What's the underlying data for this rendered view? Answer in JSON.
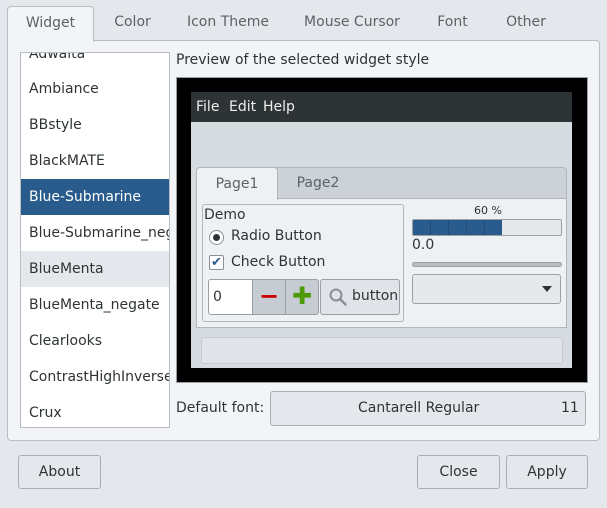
{
  "tabs": [
    "Widget",
    "Color",
    "Icon Theme",
    "Mouse Cursor",
    "Font",
    "Other"
  ],
  "active_tab": "Widget",
  "theme_list": {
    "items": [
      "Adwaita",
      "Ambiance",
      "BBstyle",
      "BlackMATE",
      "Blue-Submarine",
      "Blue-Submarine_negate",
      "BlueMenta",
      "BlueMenta_negate",
      "Clearlooks",
      "ContrastHighInverse",
      "Crux"
    ],
    "selected": "Blue-Submarine",
    "hovered": "BlueMenta"
  },
  "preview": {
    "label": "Preview of the selected widget style",
    "menu": [
      "File",
      "Edit",
      "Help"
    ],
    "inner_tabs": [
      "Page1",
      "Page2"
    ],
    "demo_label": "Demo",
    "radio_label": "Radio Button",
    "check_label": "Check Button",
    "check_mark": "✔",
    "spin_value": "0",
    "spin_minus": "−",
    "spin_plus": "✚",
    "button_label": "button",
    "progress_text": "60 %",
    "progress_fraction": 0.6,
    "scale_value": "0.0"
  },
  "default_font": {
    "label": "Default font:",
    "name": "Cantarell Regular",
    "size": "11"
  },
  "buttons": {
    "about": "About",
    "close": "Close",
    "apply": "Apply"
  },
  "colors": {
    "accent": "#2a5b8d",
    "menubar": "#2e3436",
    "preview_border": "#000000"
  }
}
